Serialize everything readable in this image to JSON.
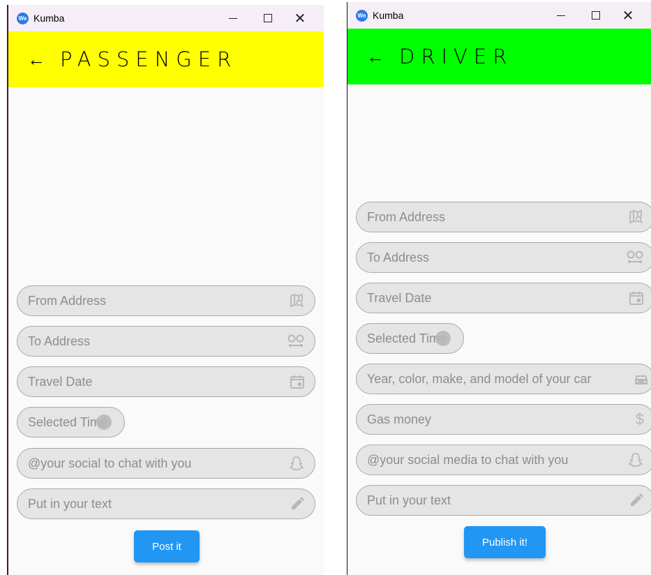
{
  "passenger": {
    "window_title": "Kumba",
    "app_icon_text": "We",
    "header_title": "PASSENGER",
    "appbar_color": "#ffff00",
    "fields": [
      {
        "label": "From Address",
        "icon": "map-search-icon"
      },
      {
        "label": "To Address",
        "icon": "route-icon"
      },
      {
        "label": "Travel Date",
        "icon": "calendar-icon"
      },
      {
        "label": "Selected Time"
      },
      {
        "label": "@your social to chat with you",
        "icon": "snapchat-icon"
      },
      {
        "label": "Put in your text",
        "icon": "pencil-icon"
      }
    ],
    "submit_label": "Post it"
  },
  "driver": {
    "window_title": "Kumba",
    "app_icon_text": "We",
    "header_title": "DRIVER",
    "appbar_color": "#00ff00",
    "fields": [
      {
        "label": "From Address",
        "icon": "map-search-icon"
      },
      {
        "label": "To Address",
        "icon": "route-icon"
      },
      {
        "label": "Travel Date",
        "icon": "calendar-icon"
      },
      {
        "label": "Selected Time"
      },
      {
        "label": "Year, color, make, and model of your car",
        "icon": "car-icon"
      },
      {
        "label": "Gas money",
        "icon": "dollar-icon"
      },
      {
        "label": "@your social media to chat with you",
        "icon": "snapchat-icon"
      },
      {
        "label": "Put in your text",
        "icon": "pencil-icon"
      }
    ],
    "submit_label": "Publish it!"
  },
  "accent_color": "#2196f3"
}
